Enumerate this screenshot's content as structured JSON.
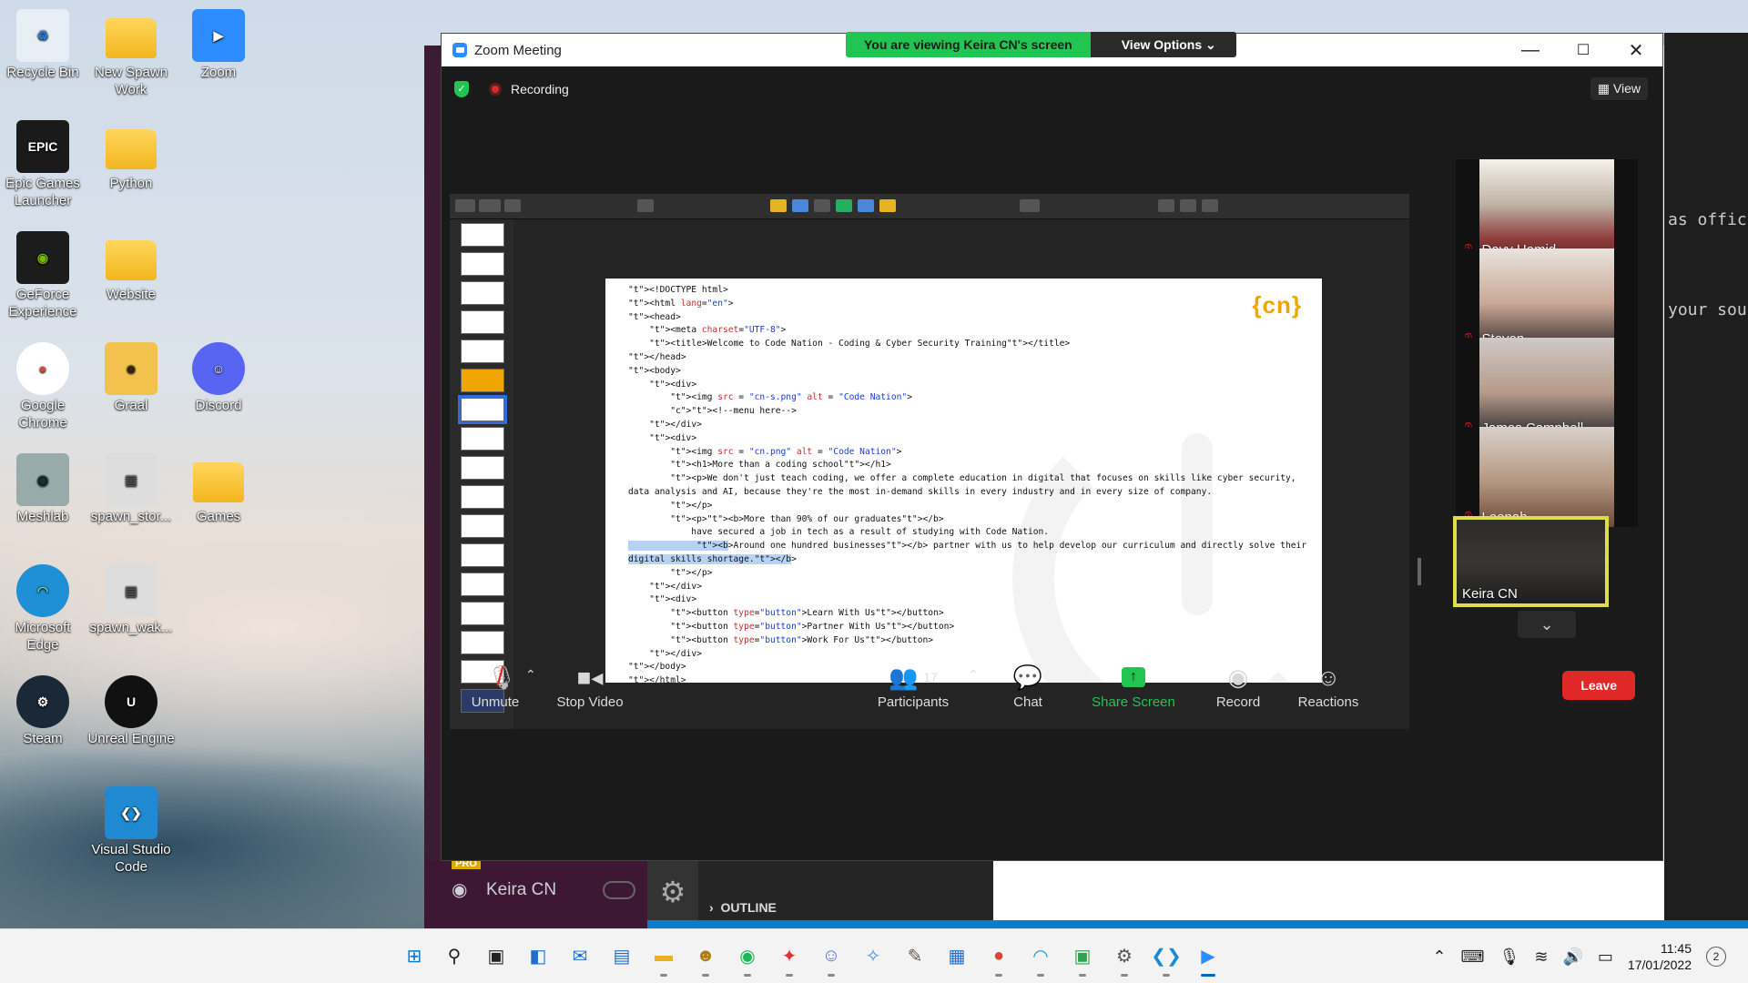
{
  "desktop_icons": [
    {
      "label": "Recycle Bin",
      "icon": "recycle-bin-icon"
    },
    {
      "label": "New Spawn Work",
      "icon": "folder-icon"
    },
    {
      "label": "Zoom",
      "icon": "zoom-icon"
    },
    {
      "label": "Epic Games Launcher",
      "icon": "epic-games-icon"
    },
    {
      "label": "Python",
      "icon": "folder-icon"
    },
    {
      "label": "GeForce Experience",
      "icon": "nvidia-icon"
    },
    {
      "label": "Website",
      "icon": "folder-icon"
    },
    {
      "label": "Google Chrome",
      "icon": "chrome-icon"
    },
    {
      "label": "Graal",
      "icon": "graal-icon"
    },
    {
      "label": "Discord",
      "icon": "discord-icon"
    },
    {
      "label": "Meshlab",
      "icon": "meshlab-icon"
    },
    {
      "label": "spawn_stor...",
      "icon": "image-file-icon"
    },
    {
      "label": "Games",
      "icon": "folder-icon"
    },
    {
      "label": "Microsoft Edge",
      "icon": "edge-icon"
    },
    {
      "label": "spawn_wak...",
      "icon": "image-file-icon"
    },
    {
      "label": "Steam",
      "icon": "steam-icon"
    },
    {
      "label": "Unreal Engine",
      "icon": "unreal-icon"
    },
    {
      "label": "Visual Studio Code",
      "icon": "vscode-icon"
    }
  ],
  "zoom": {
    "title": "Zoom Meeting",
    "banner_text": "You are viewing Keira CN's screen",
    "view_options": "View Options",
    "recording": "Recording",
    "view_label": "View",
    "participants_count": "17",
    "controls": {
      "unmute": "Unmute",
      "stop_video": "Stop Video",
      "participants": "Participants",
      "chat": "Chat",
      "share_screen": "Share Screen",
      "record": "Record",
      "reactions": "Reactions",
      "leave": "Leave"
    },
    "participants": [
      {
        "name": "Davy Hamid",
        "muted": true
      },
      {
        "name": "Steven",
        "muted": true
      },
      {
        "name": "James Campbell",
        "muted": true
      },
      {
        "name": "Leenah",
        "muted": true
      },
      {
        "name": "Keira CN",
        "muted": false,
        "active": true
      }
    ]
  },
  "slide": {
    "logo": "{cn}",
    "code_lines": [
      "<!DOCTYPE html>",
      "<html lang=\"en\">",
      "<head>",
      "    <meta charset=\"UTF-8\">",
      "    <title>Welcome to Code Nation - Coding & Cyber Security Training</title>",
      "</head>",
      "<body>",
      "    <div>",
      "        <img src = \"cn-s.png\" alt = \"Code Nation\">",
      "        <!--menu here-->",
      "    </div>",
      "    <div>",
      "        <img src = \"cn.png\" alt = \"Code Nation\">",
      "        <h1>More than a coding school</h1>",
      "        <p>We don't just teach coding, we offer a complete education in digital that focuses on skills like cyber security,",
      "data analysis and AI, because they're the most in-demand skills in every industry and in every size of company.",
      "        </p>",
      "        <p><b>More than 90% of our graduates</b>",
      "            have secured a job in tech as a result of studying with Code Nation.",
      "             <b>Around one hundred businesses</b> partner with us to help develop our curriculum and directly solve their",
      "digital skills shortage.</b>",
      "        </p>",
      "    </div>",
      "    <div>",
      "        <button type=\"button\">Learn With Us</button>",
      "        <button type=\"button\">Partner With Us</button>",
      "        <button type=\"button\">Work For Us</button>",
      "    </div>",
      "</body>",
      "</html>"
    ]
  },
  "background_app": {
    "user": "Keira CN",
    "pro_badge": "PRO",
    "outline": "OUTLINE",
    "right_text_1": "as offici",
    "right_text_2": "your soul"
  },
  "taskbar": {
    "time": "11:45",
    "date": "17/01/2022",
    "notifications": "2"
  }
}
